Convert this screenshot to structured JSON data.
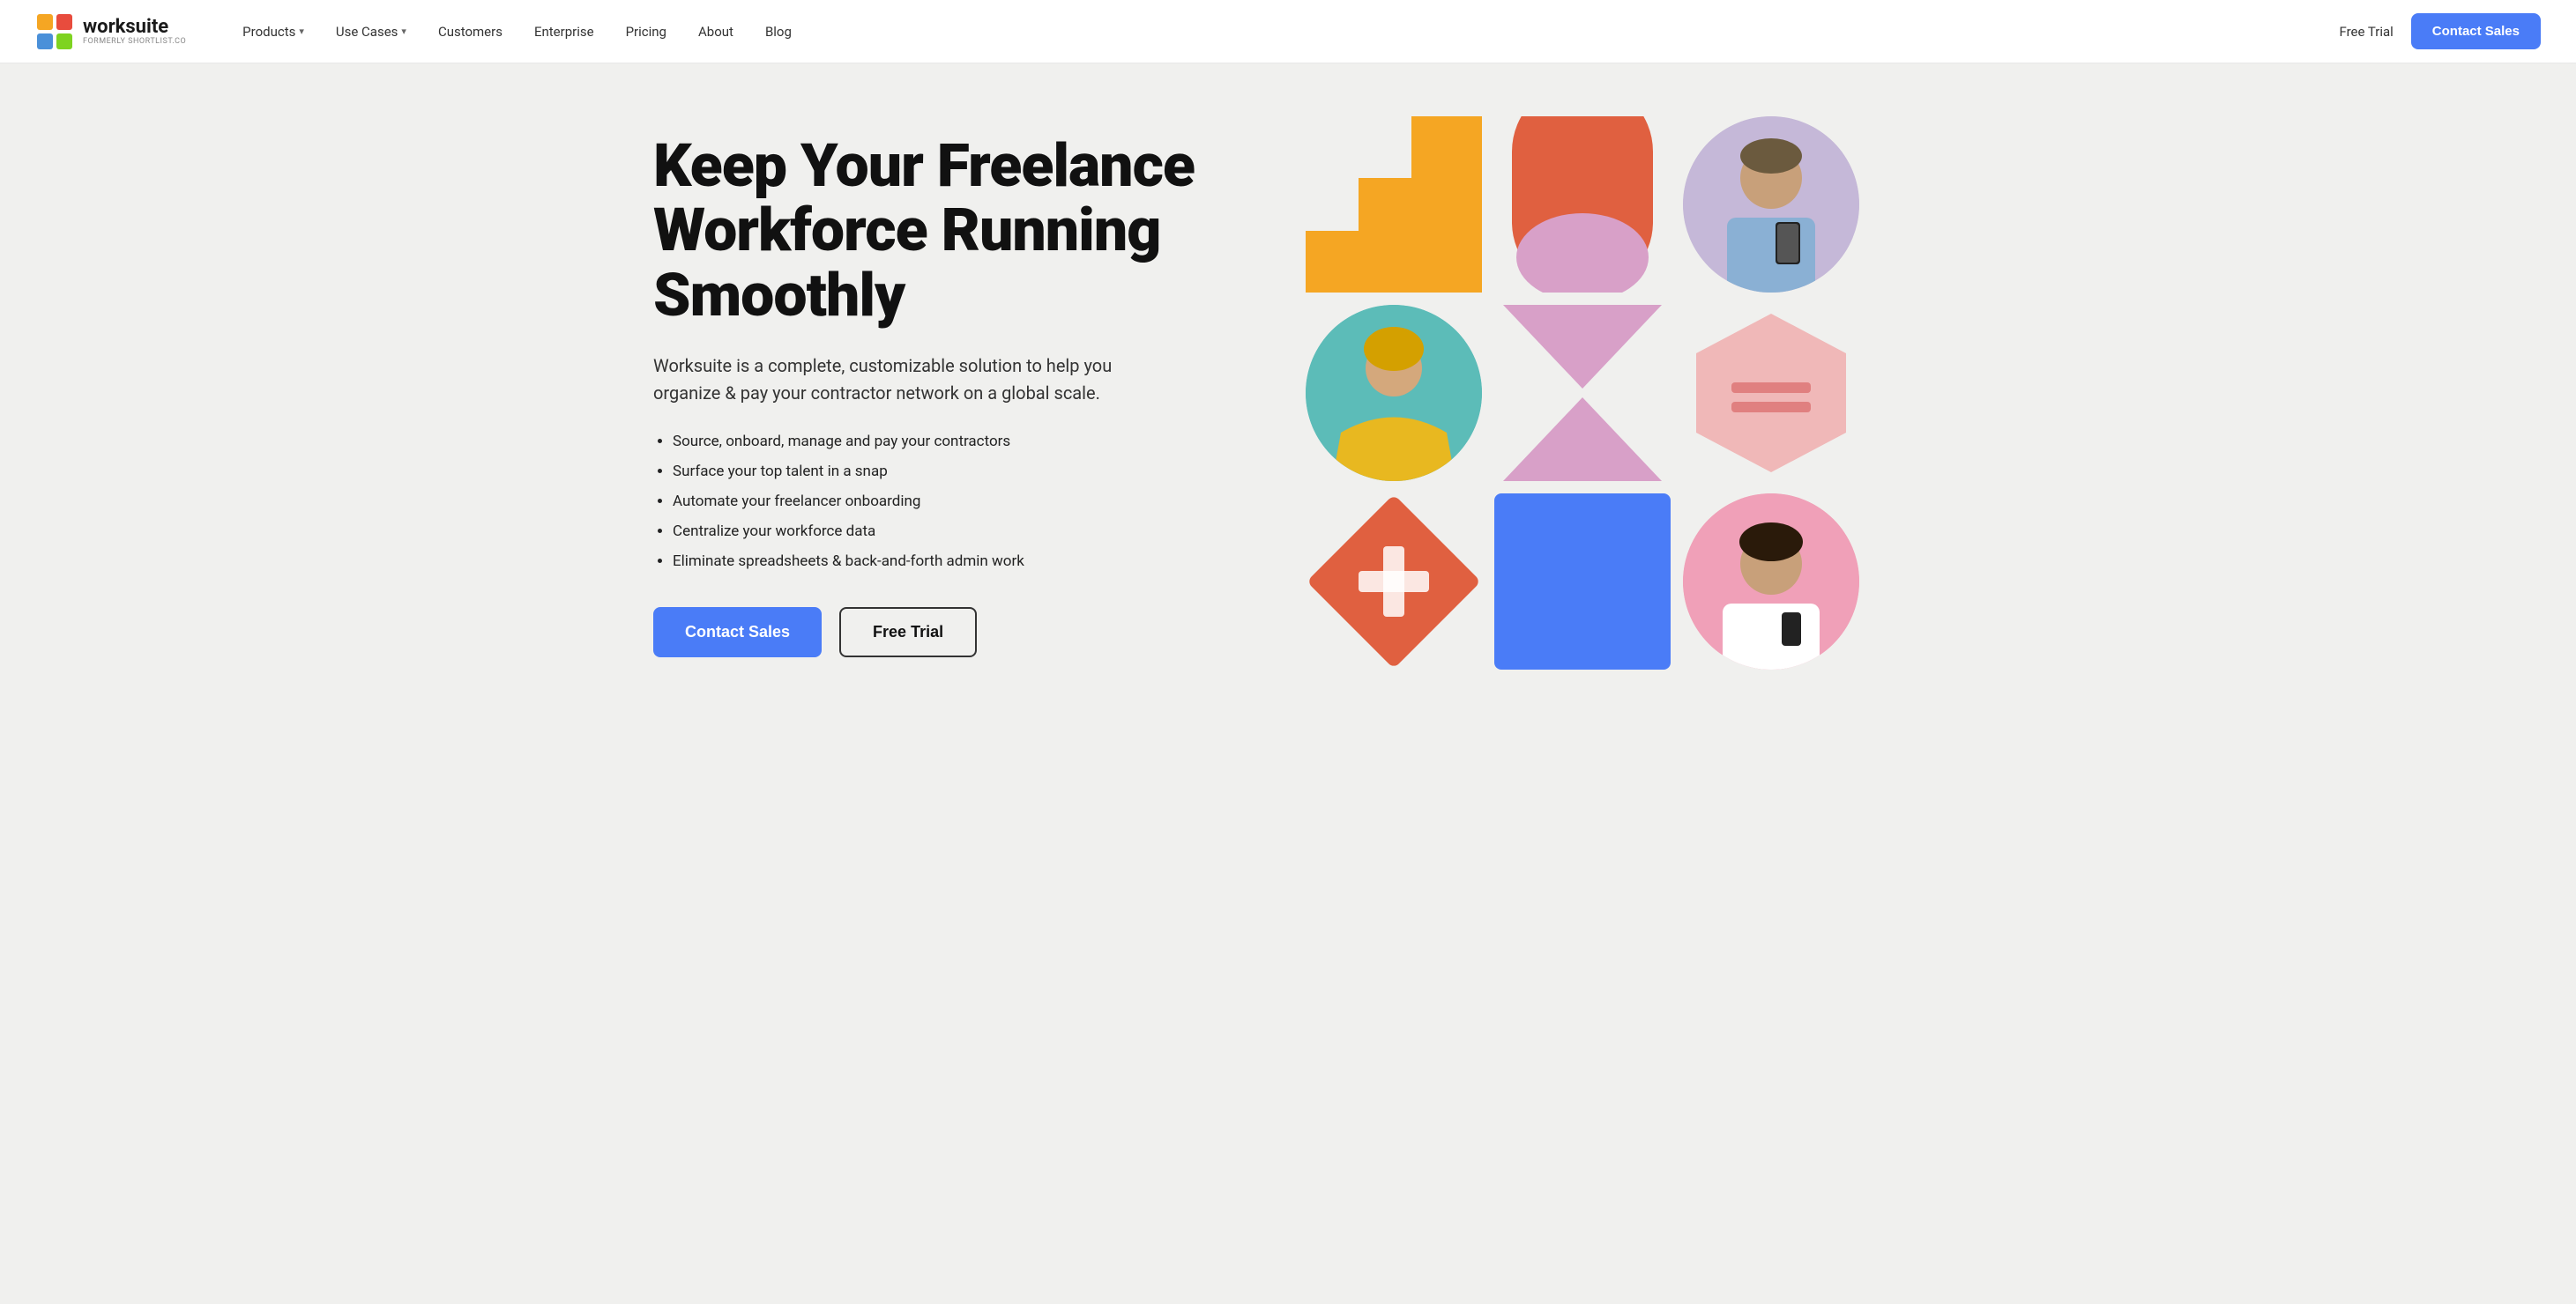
{
  "nav": {
    "logo_title": "worksuite",
    "logo_subtitle": "FORMERLY SHORTLIST.CO",
    "links": [
      {
        "label": "Products",
        "has_dropdown": true
      },
      {
        "label": "Use Cases",
        "has_dropdown": true
      },
      {
        "label": "Customers",
        "has_dropdown": false
      },
      {
        "label": "Enterprise",
        "has_dropdown": false
      },
      {
        "label": "Pricing",
        "has_dropdown": false
      },
      {
        "label": "About",
        "has_dropdown": false
      },
      {
        "label": "Blog",
        "has_dropdown": false
      }
    ],
    "free_trial_label": "Free Trial",
    "contact_sales_label": "Contact Sales"
  },
  "hero": {
    "title": "Keep Your Freelance Workforce Running Smoothly",
    "subtitle": "Worksuite is a complete, customizable solution to help you organize & pay your contractor network on a global scale.",
    "bullets": [
      "Source, onboard, manage and pay your contractors",
      "Surface your top talent in a snap",
      "Automate your freelancer onboarding",
      "Centralize your workforce data",
      "Eliminate spreadsheets & back-and-forth admin work"
    ],
    "cta_primary": "Contact Sales",
    "cta_secondary": "Free Trial"
  }
}
